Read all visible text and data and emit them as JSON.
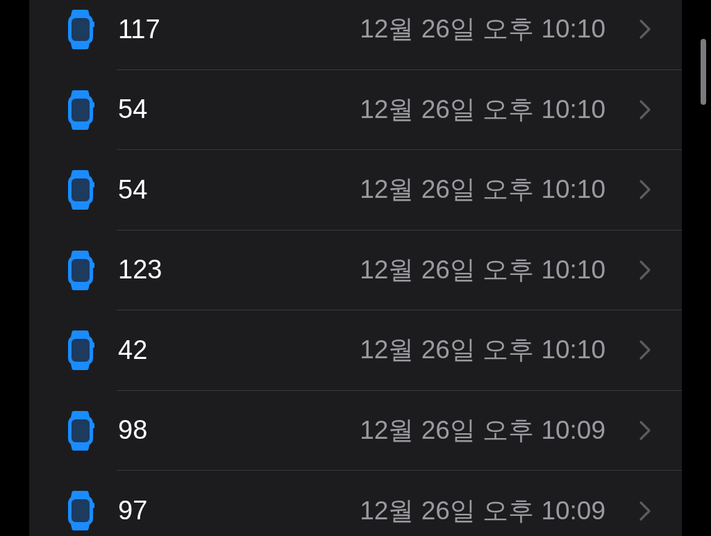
{
  "rows": [
    {
      "name": "117",
      "time": "12월 26일 오후 10:10"
    },
    {
      "name": "54",
      "time": "12월 26일 오후 10:10"
    },
    {
      "name": "54",
      "time": "12월 26일 오후 10:10"
    },
    {
      "name": "123",
      "time": "12월 26일 오후 10:10"
    },
    {
      "name": "42",
      "time": "12월 26일 오후 10:10"
    },
    {
      "name": "98",
      "time": "12월 26일 오후 10:09"
    },
    {
      "name": "97",
      "time": "12월 26일 오후 10:09"
    }
  ]
}
